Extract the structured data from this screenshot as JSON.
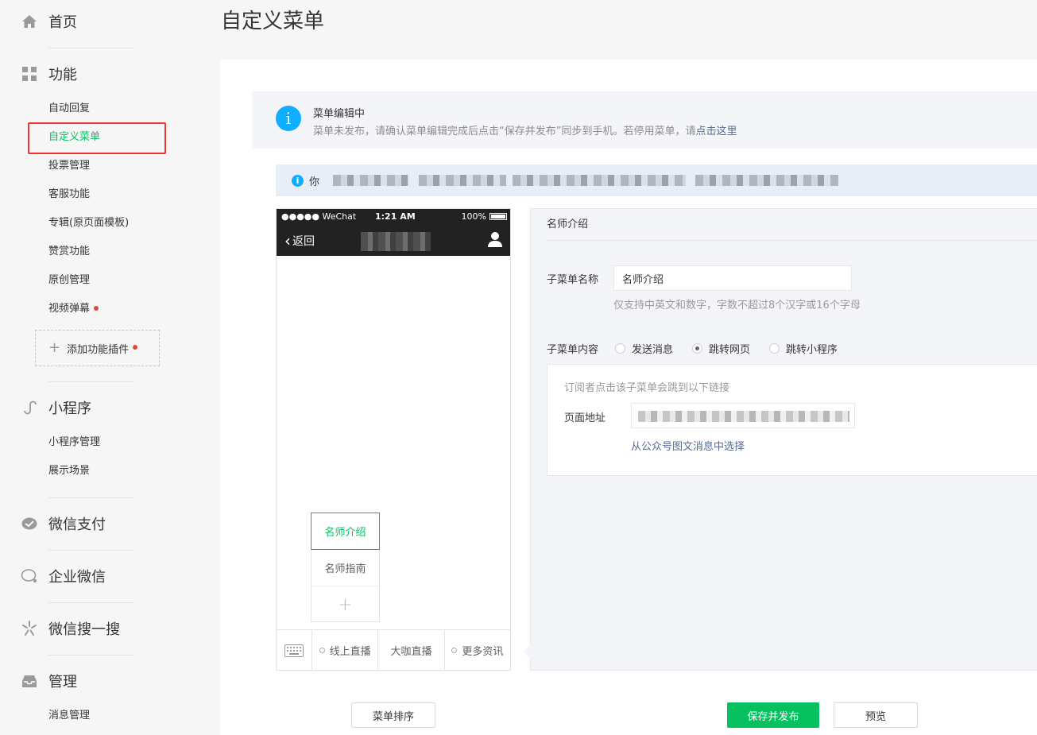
{
  "sidebar": {
    "home": "首页",
    "features": {
      "title": "功能",
      "items": [
        "自动回复",
        "自定义菜单",
        "投票管理",
        "客服功能",
        "专辑(原页面模板)",
        "赞赏功能",
        "原创管理",
        "视频弹幕"
      ],
      "add_plugin": "添加功能插件"
    },
    "miniprogram": {
      "title": "小程序",
      "items": [
        "小程序管理",
        "展示场景"
      ]
    },
    "wechat_pay": "微信支付",
    "work_wechat": "企业微信",
    "wechat_search": "微信搜一搜",
    "manage": {
      "title": "管理",
      "items": [
        "消息管理"
      ]
    }
  },
  "page_title": "自定义菜单",
  "notice": {
    "title": "菜单编辑中",
    "desc_prefix": "菜单未发布，请确认菜单编辑完成后点击“保存并发布”同步到手机。若停用菜单，请",
    "desc_link": "点击这里"
  },
  "info_bar": {
    "text_visible": "你"
  },
  "phone": {
    "carrier": "●●●●● WeChat",
    "time": "1:21 AM",
    "battery": "100%",
    "back": "返回",
    "submenu": [
      "名师介绍",
      "名师指南"
    ],
    "menubar": [
      "线上直播",
      "大咖直播",
      "更多资讯"
    ]
  },
  "editor": {
    "header": "名师介绍",
    "name_label": "子菜单名称",
    "name_value": "名师介绍",
    "name_hint": "仅支持中英文和数字，字数不超过8个汉字或16个字母",
    "content_label": "子菜单内容",
    "options": [
      "发送消息",
      "跳转网页",
      "跳转小程序"
    ],
    "selected_option": "跳转网页",
    "link_desc": "订阅者点击该子菜单会跳到以下链接",
    "url_label": "页面地址",
    "choose_link": "从公众号图文消息中选择"
  },
  "buttons": {
    "sort": "菜单排序",
    "save_publish": "保存并发布",
    "preview": "预览"
  },
  "colors": {
    "accent": "#07c160",
    "link": "#576b95",
    "highlight_border": "#ee3333",
    "badge": "#e64340"
  }
}
